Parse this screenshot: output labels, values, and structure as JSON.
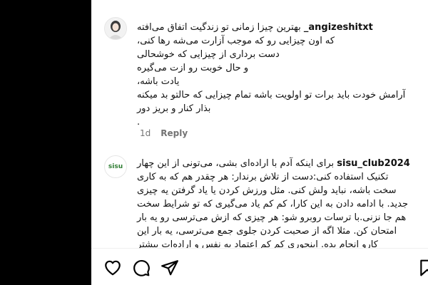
{
  "comments": [
    {
      "username": "_angizeshitxt",
      "lines": [
        "بهترین چیزا زمانی تو زندگیت اتفاق می‌افته",
        "که اون چیزایی رو که موجب آزارت می‌شه رها کنی،",
        "دست برداری از چیزایی که خوشحالی",
        "و حال خوبت رو ازت می‌گیره",
        "یادت باشه،",
        "آرامش خودت باید برات تو اولویت باشه تمام چیزایی که حالتو بد میکنه",
        "بذار کنار و بریز دور",
        "."
      ],
      "time": "1d",
      "reply_label": "Reply"
    },
    {
      "username": "sisu_club2024",
      "lines": [
        "برای اینکه آدم با اراده‌ای بشی، می‌تونی از این چهار",
        "تکنیک استفاده کنی:دست از تلاش برندار: هر چقدر هم که به کاری",
        "سخت باشه، نباید ولش کنی. مثل ورزش کردن یا یاد گرفتن یه چیزی",
        "جدید. با ادامه دادن به این کارا، کم کم یاد می‌گیری که تو شرایط سخت",
        "هم جا نزنی.با ترسات روبرو شو: هر چیزی که ازش می‌ترسی رو یه بار",
        "امتحان کن. مثلا اگه از صحبت کردن جلوی جمع می‌ترسی، یه بار این",
        "کارو انجام بده. اینجوری کم کم اعتماد به نفس و اراده‌ات بیشتر"
      ],
      "avatar_text": "sisu"
    }
  ],
  "actions": [
    "like-icon",
    "comment-icon",
    "share-icon",
    "save-icon"
  ]
}
